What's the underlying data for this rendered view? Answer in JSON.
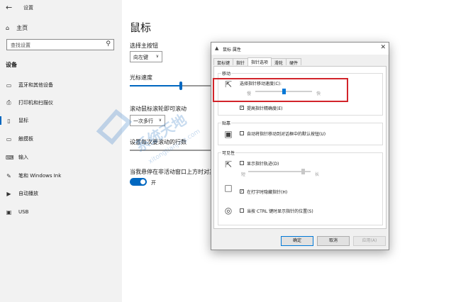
{
  "window": {
    "title": "设置",
    "back_icon": "back-arrow-icon"
  },
  "sidebar": {
    "home_label": "主页",
    "search_placeholder": "查找设置",
    "section_label": "设备",
    "items": [
      {
        "label": "蓝牙和其他设备",
        "icon": "bluetooth-icon"
      },
      {
        "label": "打印机和扫描仪",
        "icon": "printer-icon"
      },
      {
        "label": "鼠标",
        "icon": "mouse-icon",
        "active": true
      },
      {
        "label": "触摸板",
        "icon": "touchpad-icon"
      },
      {
        "label": "输入",
        "icon": "keyboard-icon"
      },
      {
        "label": "笔和 Windows Ink",
        "icon": "pen-icon"
      },
      {
        "label": "自动播放",
        "icon": "autoplay-icon"
      },
      {
        "label": "USB",
        "icon": "usb-icon"
      }
    ]
  },
  "main": {
    "title": "鼠标",
    "primary_button_label": "选择主按钮",
    "primary_button_value": "向左键",
    "cursor_speed_label": "光标速度",
    "cursor_speed_level": 0.6,
    "wheel_label": "滚动鼠标滚轮即可滚动",
    "wheel_value": "一次多行",
    "lines_label": "设置每次要滚动的行数",
    "inactive_label": "当我悬停在非活动窗口上方时对其",
    "toggle_on": true,
    "toggle_label": "开"
  },
  "watermark": {
    "text": "系统天地",
    "url": "xitongtianjing.com"
  },
  "dialog": {
    "title": "鼠标 属性",
    "tabs": [
      "鼠标键",
      "指针",
      "指针选项",
      "滑轮",
      "硬件"
    ],
    "active_tab": 2,
    "motion": {
      "group_label": "移动",
      "speed_label": "选择指针移动速度(C):",
      "slow_label": "慢",
      "fast_label": "快",
      "speed_level": 0.5,
      "precision_label": "提高指针精确度(E)",
      "precision_checked": true
    },
    "snap": {
      "group_label": "贴靠",
      "snap_label": "自动将指针移动到对话框中的默认按钮(U)",
      "snap_checked": false
    },
    "visibility": {
      "group_label": "可见性",
      "trails_label": "显示指针轨迹(D)",
      "trails_checked": false,
      "short_label": "短",
      "long_label": "长",
      "trails_level": 0.9,
      "hide_label": "在打字时隐藏指针(H)",
      "hide_checked": true,
      "ctrl_label": "当按 CTRL 键时显示指针的位置(S)",
      "ctrl_checked": false
    },
    "buttons": {
      "ok": "确定",
      "cancel": "取消",
      "apply": "应用(A)"
    }
  },
  "colors": {
    "accent": "#0067c0",
    "highlight_box": "#d2242a"
  }
}
